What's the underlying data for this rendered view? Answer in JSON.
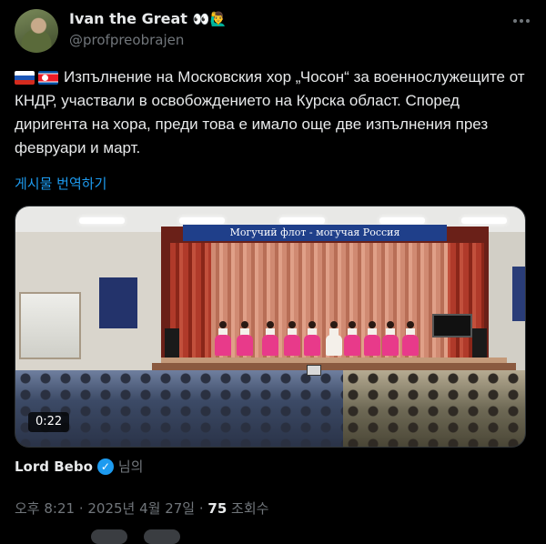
{
  "author": {
    "display_name": "Ivan the Great",
    "emoji": "👀🙋‍♂️",
    "handle": "@profpreobrajen"
  },
  "post": {
    "flags": [
      "russia-flag-icon",
      "north-korea-flag-icon"
    ],
    "text": "Изпълнение на Московския хор „Чосон“ за военнослужещите от КНДР, участвали в освобождението на Курска област. Според диригента на хора, преди това е имало още две изпълнения през февруари и март.",
    "translate_label": "게시물 번역하기"
  },
  "media": {
    "banner_text": "Могучий флот - могучая Россия",
    "duration": "0:22"
  },
  "credit": {
    "name": "Lord Bebo",
    "suffix": "님의"
  },
  "meta": {
    "timestamp": "오후 8:21 · 2025년 4월 27일 · ",
    "views_count": "75",
    "views_label": " 조회수"
  },
  "colors": {
    "background": "#000000",
    "text": "#e7e9ea",
    "secondary": "#71767b",
    "link": "#1d9bf0"
  }
}
